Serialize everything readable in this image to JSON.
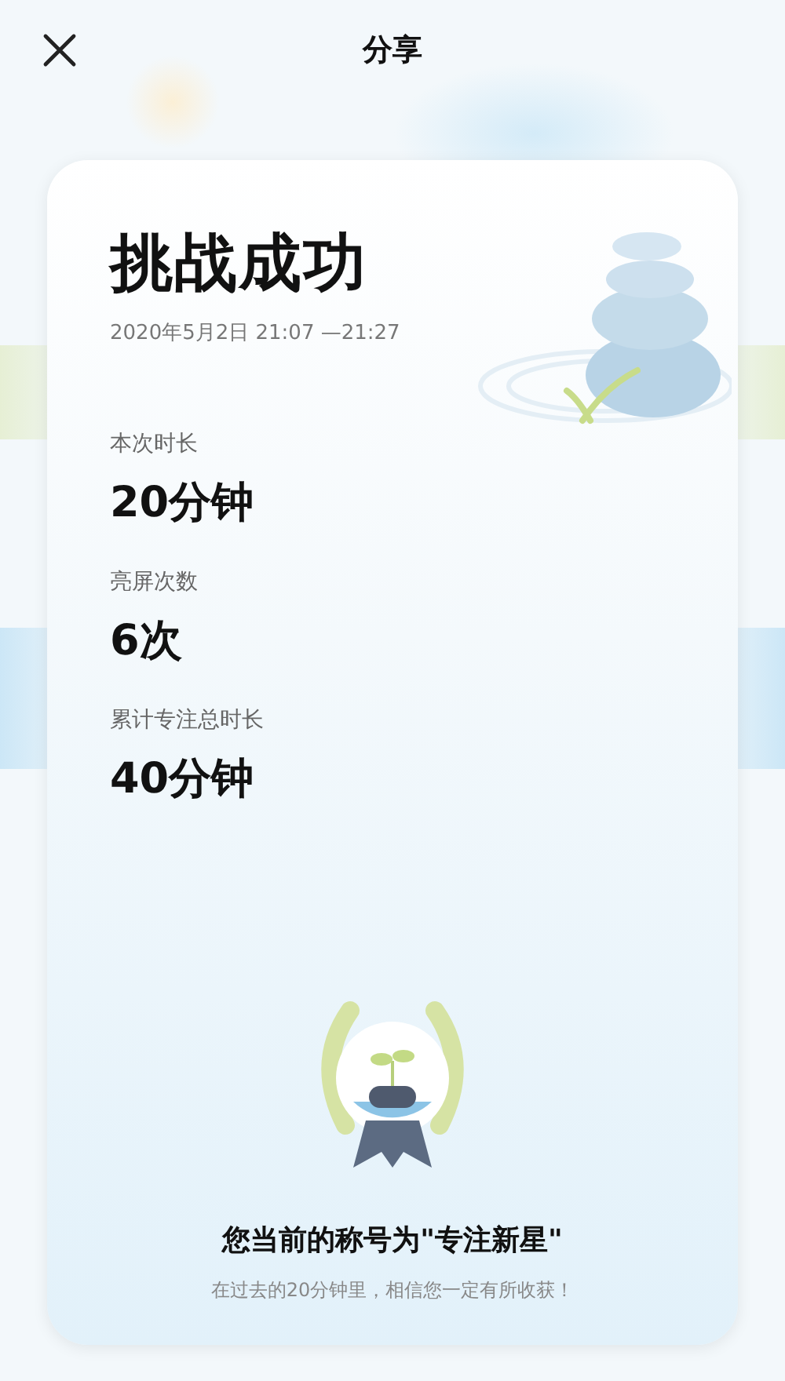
{
  "header": {
    "title": "分享"
  },
  "card": {
    "title": "挑战成功",
    "date": "2020年5月2日  21:07 —21:27",
    "stats": [
      {
        "label": "本次时长",
        "value": "20分钟"
      },
      {
        "label": "亮屏次数",
        "value": "6次"
      },
      {
        "label": "累计专注总时长",
        "value": "40分钟"
      }
    ],
    "rank_title": "您当前的称号为\"专注新星\"",
    "rank_note": "在过去的20分钟里，相信您一定有所收获！"
  }
}
